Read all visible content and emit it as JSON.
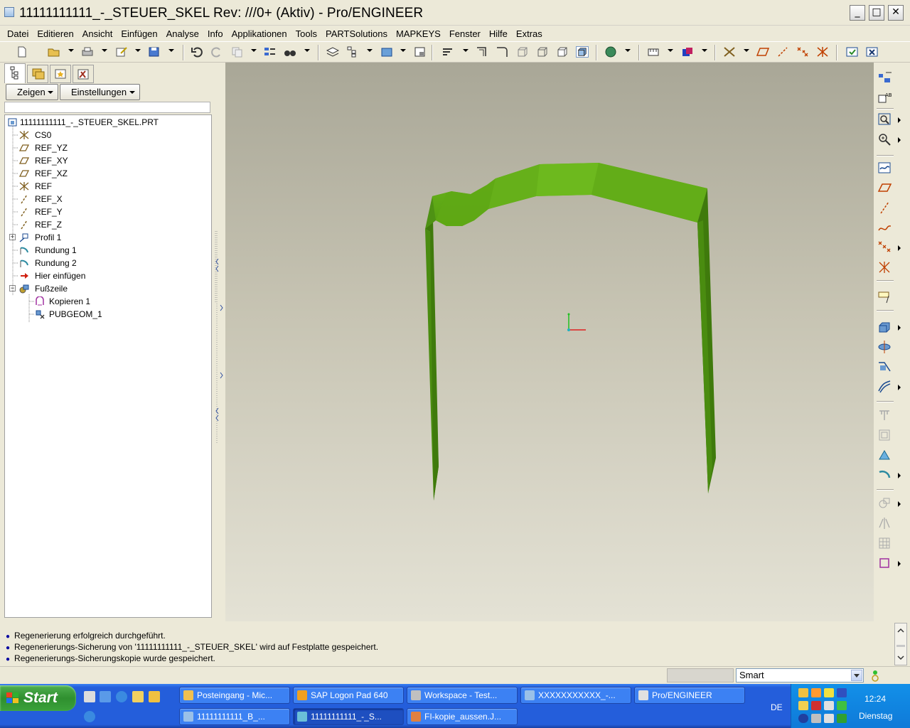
{
  "window": {
    "title": "11111111111_-_STEUER_SKEL Rev: ///0+ (Aktiv) - Pro/ENGINEER",
    "minimize": "_",
    "maximize": "□",
    "close": "✕"
  },
  "menu": [
    "Datei",
    "Editieren",
    "Ansicht",
    "Einfügen",
    "Analyse",
    "Info",
    "Applikationen",
    "Tools",
    "PARTSolutions",
    "MAPKEYS",
    "Fenster",
    "Hilfe",
    "Extras"
  ],
  "left_panel": {
    "show_button": "Zeigen",
    "settings_button": "Einstellungen",
    "tree": [
      {
        "label": "11111111111_-_STEUER_SKEL.PRT",
        "icon": "part-icon"
      },
      {
        "label": "CS0",
        "icon": "coordinate-system-icon"
      },
      {
        "label": "REF_YZ",
        "icon": "datum-plane-icon"
      },
      {
        "label": "REF_XY",
        "icon": "datum-plane-icon"
      },
      {
        "label": "REF_XZ",
        "icon": "datum-plane-icon"
      },
      {
        "label": "REF",
        "icon": "coordinate-system-icon"
      },
      {
        "label": "REF_X",
        "icon": "datum-axis-icon"
      },
      {
        "label": "REF_Y",
        "icon": "datum-axis-icon"
      },
      {
        "label": "REF_Z",
        "icon": "datum-axis-icon"
      },
      {
        "label": "Profil 1",
        "icon": "sketch-icon"
      },
      {
        "label": "Rundung 1",
        "icon": "round-icon"
      },
      {
        "label": "Rundung 2",
        "icon": "round-icon"
      },
      {
        "label": "Hier einfügen",
        "icon": "insert-arrow-icon"
      },
      {
        "label": "Fußzeile",
        "icon": "footer-icon"
      },
      {
        "label": "Kopieren 1",
        "icon": "copy-geometry-icon"
      },
      {
        "label": "PUBGEOM_1",
        "icon": "published-geometry-icon"
      }
    ]
  },
  "messages": [
    "Regenerierung erfolgreich durchgeführt.",
    "Regenerierungs-Sicherung von '11111111111_-_STEUER_SKEL' wird auf Festplatte gespeichert.",
    "Regenerierungs-Sicherungskopie wurde gespeichert."
  ],
  "status": {
    "filter_value": "Smart"
  },
  "taskbar": {
    "start": "Start",
    "tasks_row1": [
      "Posteingang - Mic...",
      "SAP Logon Pad 640",
      "Workspace - Test...",
      "XXXXXXXXXXX_-...",
      "Pro/ENGINEER"
    ],
    "tasks_row2": [
      "11111111111_B_...",
      "11111111111_-_S...",
      "FI-kopie_aussen.J..."
    ],
    "language": "DE",
    "time": "12:24",
    "day": "Dienstag"
  },
  "colors": {
    "model_green_light": "#6ab21a",
    "model_green_dark": "#3e7a0c",
    "taskbar_blue": "#245edb",
    "start_green": "#3aa23a"
  }
}
